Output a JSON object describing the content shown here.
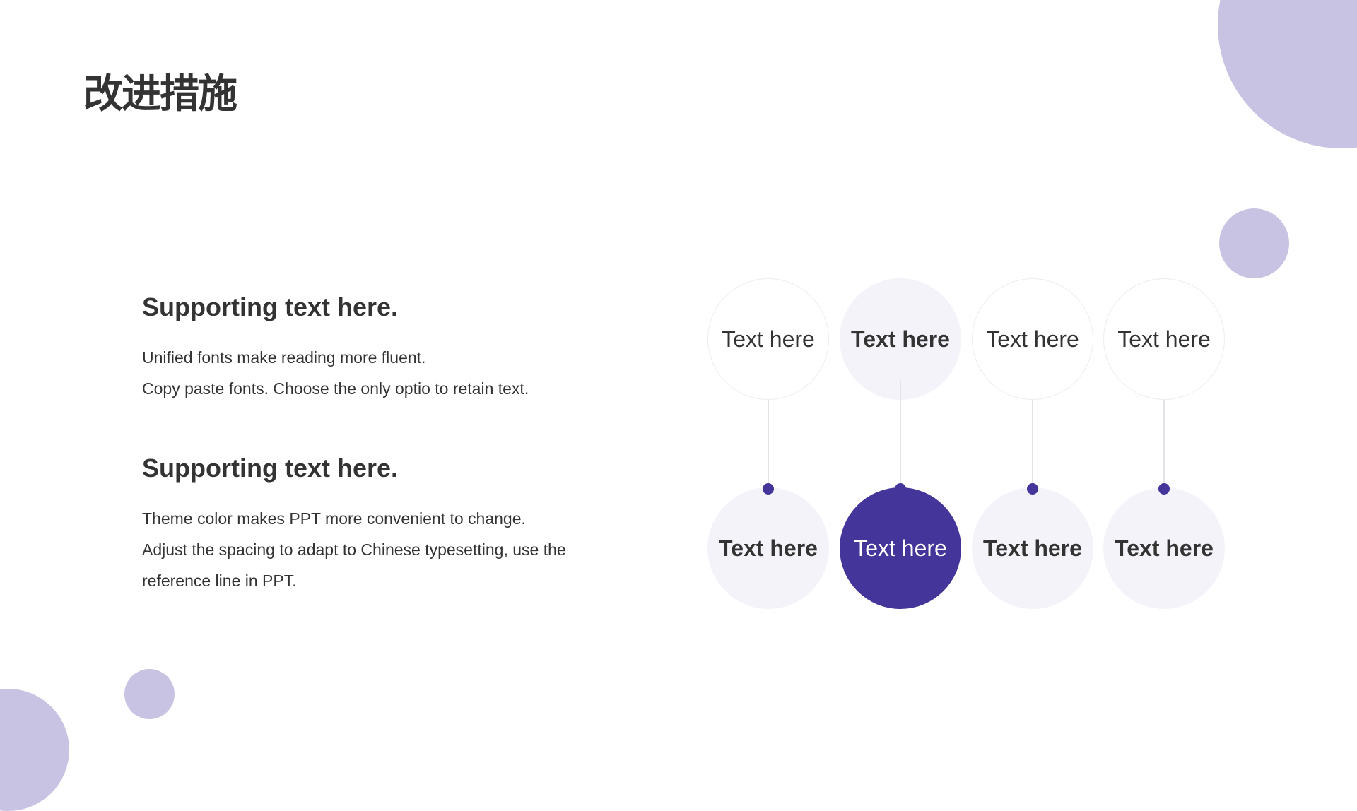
{
  "slide": {
    "title": "改进措施",
    "sections": [
      {
        "heading": "Supporting text here.",
        "lines": [
          "Unified fonts make reading more fluent.",
          "Copy paste fonts. Choose the only optio to retain text."
        ]
      },
      {
        "heading": "Supporting text here.",
        "lines": [
          "Theme color makes PPT more convenient to change.",
          "Adjust the spacing to adapt to Chinese typesetting, use the",
          "reference line in PPT."
        ]
      }
    ],
    "diagram": {
      "columns": [
        {
          "top_label": "Text here",
          "bottom_label": "Text here"
        },
        {
          "top_label": "Text here",
          "bottom_label": "Text here"
        },
        {
          "top_label": "Text here",
          "bottom_label": "Text here"
        },
        {
          "top_label": "Text here",
          "bottom_label": "Text here"
        }
      ],
      "highlighted_column": 2
    },
    "colors": {
      "accent": "#44359b",
      "decor": "#c8c3e3",
      "tint": "#f4f3fa",
      "text": "#333333"
    }
  }
}
